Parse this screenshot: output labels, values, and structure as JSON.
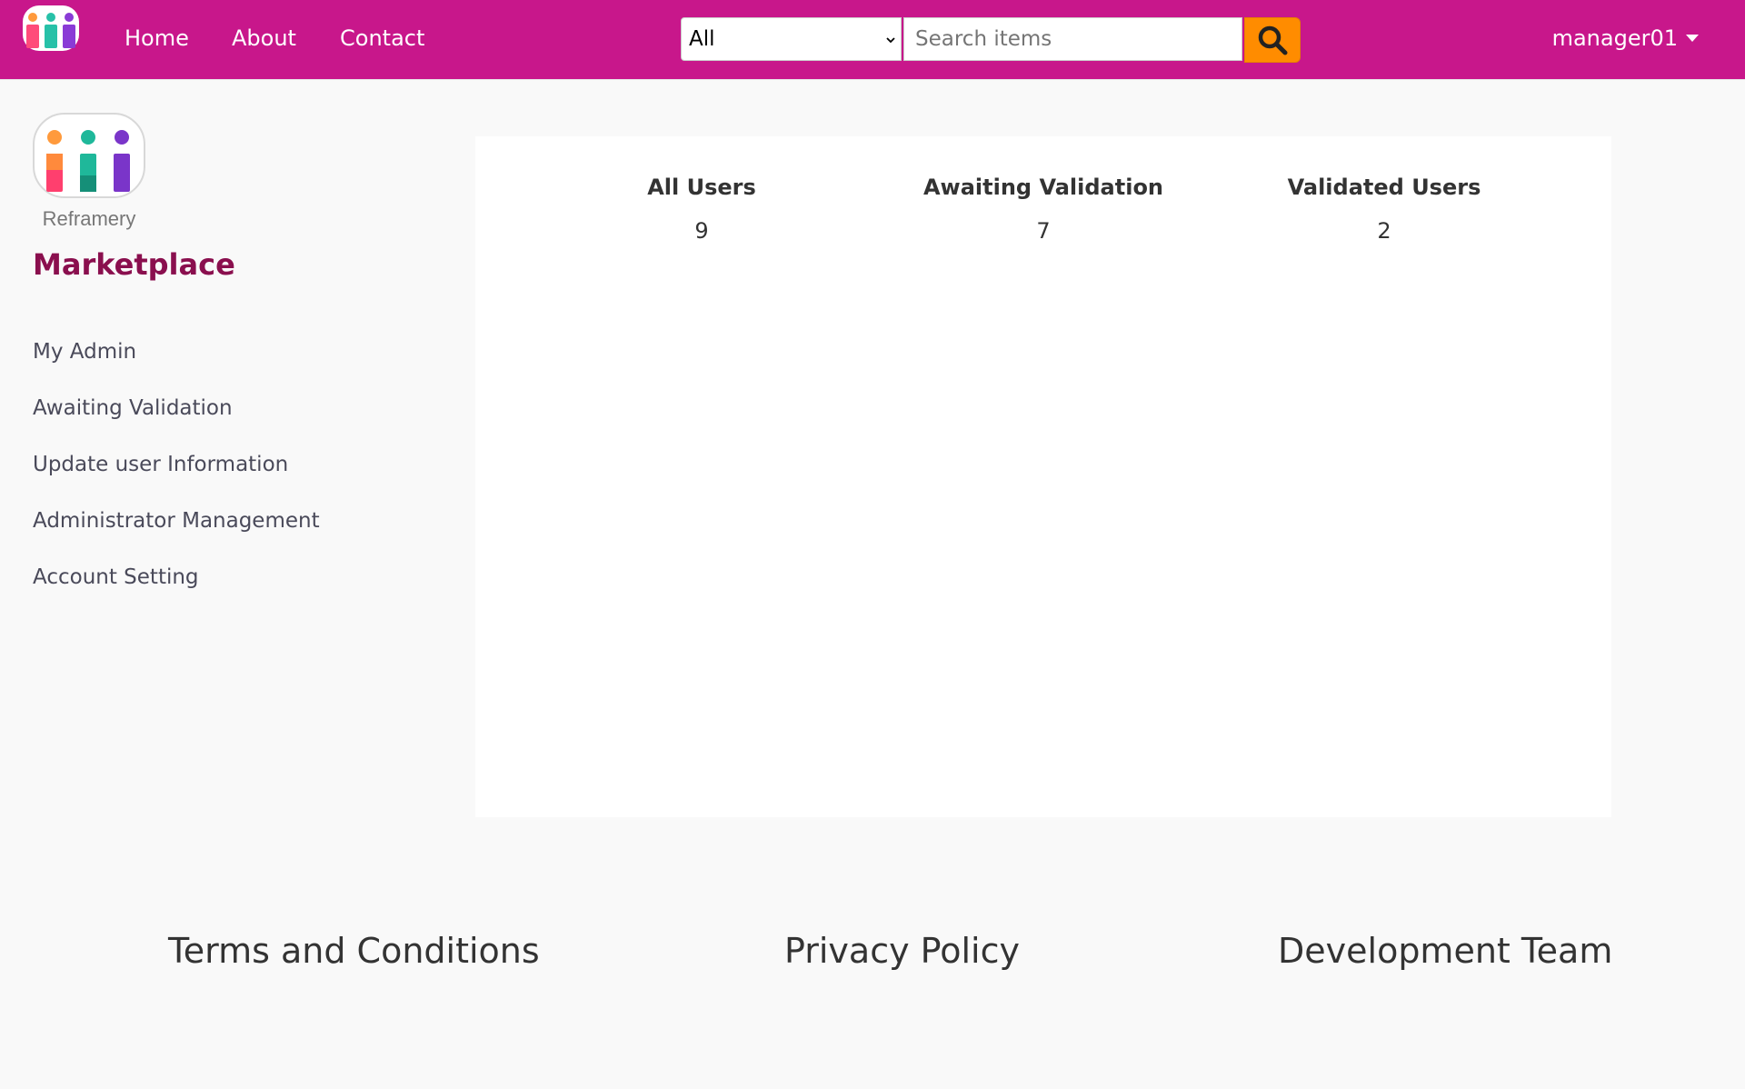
{
  "navbar": {
    "logo_icon": "reframery-logo-icon",
    "links": [
      "Home",
      "About",
      "Contact"
    ],
    "search": {
      "category_selected": "All",
      "placeholder": "Search items",
      "button_icon": "search-icon"
    },
    "user": "manager01"
  },
  "sidebar": {
    "logo_text": "Reframery",
    "title": "Marketplace",
    "items": [
      {
        "label": "My Admin"
      },
      {
        "label": "Awaiting Validation"
      },
      {
        "label": "Update user Information"
      },
      {
        "label": "Administrator Management"
      },
      {
        "label": "Account Setting"
      }
    ]
  },
  "stats": [
    {
      "label": "All Users",
      "value": "9"
    },
    {
      "label": "Awaiting Validation",
      "value": "7"
    },
    {
      "label": "Validated Users",
      "value": "2"
    }
  ],
  "footer": {
    "links": [
      "Terms and Conditions",
      "Privacy Policy",
      "Development Team"
    ]
  },
  "colors": {
    "navbar": "#c8178b",
    "search_button": "#ff8c00",
    "sidebar_title": "#8a0f4e",
    "background": "#f9f9f9"
  }
}
